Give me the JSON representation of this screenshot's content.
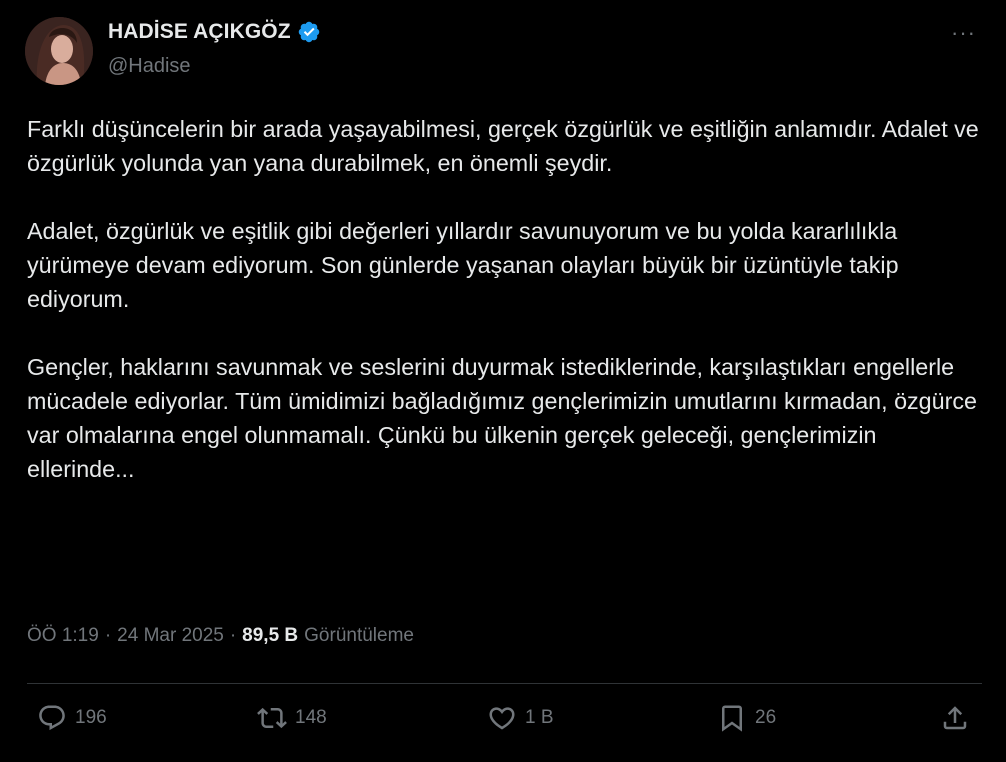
{
  "author": {
    "display_name": "HADİSE AÇIKGÖZ",
    "handle": "@Hadise",
    "verified_color": "#1d9bf0"
  },
  "more_label": "···",
  "paragraphs": [
    "Farklı düşüncelerin bir arada yaşayabilmesi, gerçek özgürlük ve eşitliğin anlamıdır. Adalet ve özgürlük yolunda yan yana durabilmek, en önemli şeydir.",
    "Adalet, özgürlük ve eşitlik gibi değerleri yıllardır savunuyorum ve bu yolda kararlılıkla yürümeye devam ediyorum. Son günlerde yaşanan olayları büyük bir üzüntüyle takip ediyorum.",
    "Gençler, haklarını savunmak ve seslerini duyurmak istediklerinde, karşılaştıkları engellerle mücadele ediyorlar. Tüm ümidimizi bağladığımız gençlerimizin umutlarını kırmadan, özgürce var olmalarına engel olunmamalı. Çünkü bu ülkenin gerçek geleceği, gençlerimizin ellerinde..."
  ],
  "meta": {
    "time": "ÖÖ 1:19",
    "date": "24 Mar 2025",
    "separator": "·",
    "views_count": "89,5 B",
    "views_label": "Görüntüleme"
  },
  "actions": {
    "reply_count": "196",
    "retweet_count": "148",
    "like_count": "1 B",
    "bookmark_count": "26"
  },
  "icons": {
    "reply": "reply-icon",
    "retweet": "retweet-icon",
    "like": "heart-icon",
    "bookmark": "bookmark-icon",
    "share": "share-icon",
    "verified": "verified-badge-icon",
    "more": "more-icon"
  }
}
